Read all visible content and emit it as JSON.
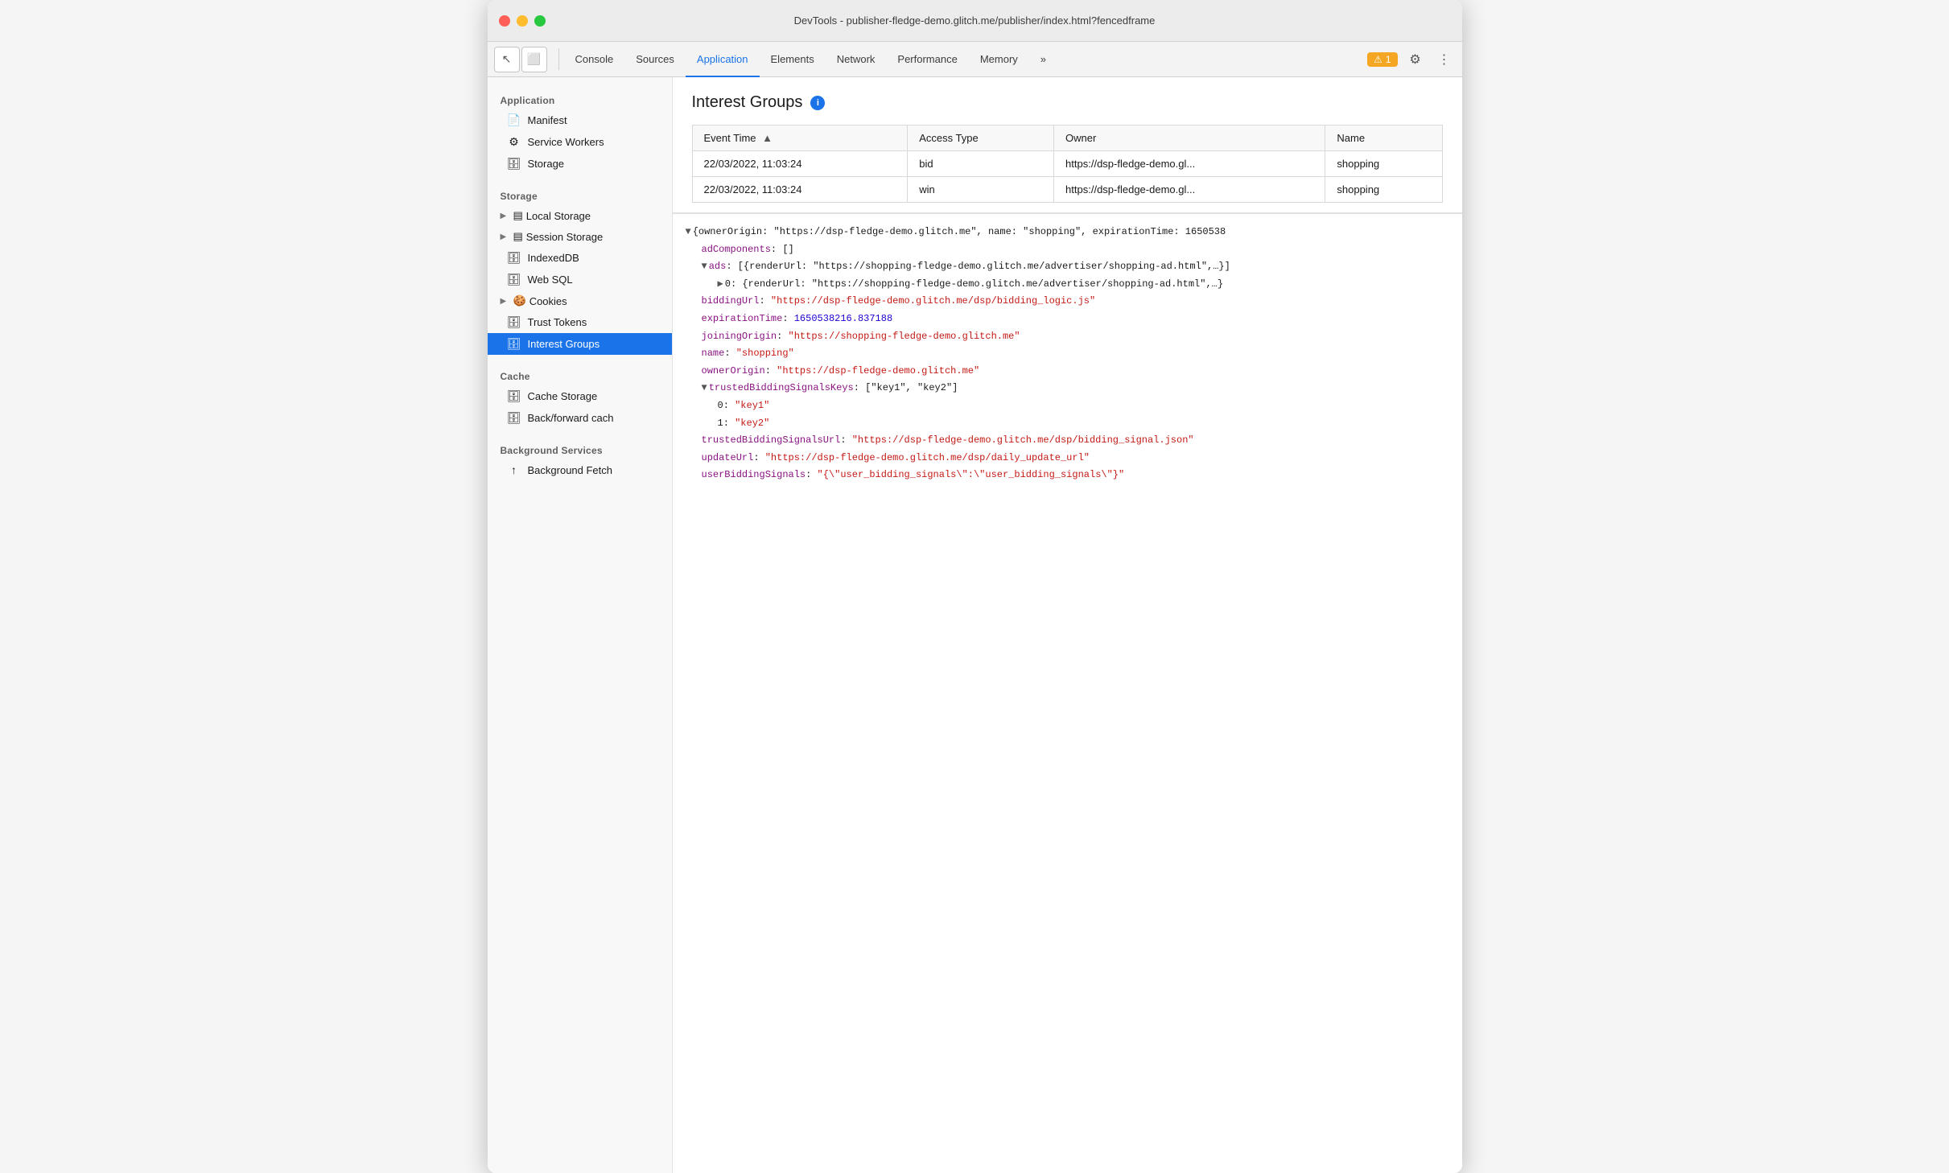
{
  "window": {
    "title": "DevTools - publisher-fledge-demo.glitch.me/publisher/index.html?fencedframe"
  },
  "toolbar": {
    "tabs": [
      {
        "id": "console",
        "label": "Console",
        "active": false
      },
      {
        "id": "sources",
        "label": "Sources",
        "active": false
      },
      {
        "id": "application",
        "label": "Application",
        "active": true
      },
      {
        "id": "elements",
        "label": "Elements",
        "active": false
      },
      {
        "id": "network",
        "label": "Network",
        "active": false
      },
      {
        "id": "performance",
        "label": "Performance",
        "active": false
      },
      {
        "id": "memory",
        "label": "Memory",
        "active": false
      }
    ],
    "more_label": "»",
    "warning_count": "1",
    "settings_icon": "⚙",
    "more_icon": "⋮"
  },
  "sidebar": {
    "sections": [
      {
        "title": "Application",
        "items": [
          {
            "id": "manifest",
            "label": "Manifest",
            "icon": "📄",
            "active": false,
            "expandable": false
          },
          {
            "id": "service-workers",
            "label": "Service Workers",
            "icon": "⚙",
            "active": false,
            "expandable": false
          },
          {
            "id": "storage",
            "label": "Storage",
            "icon": "🗄",
            "active": false,
            "expandable": false
          }
        ]
      },
      {
        "title": "Storage",
        "items": [
          {
            "id": "local-storage",
            "label": "Local Storage",
            "icon": "▤",
            "active": false,
            "expandable": true,
            "expanded": false
          },
          {
            "id": "session-storage",
            "label": "Session Storage",
            "icon": "▤",
            "active": false,
            "expandable": true,
            "expanded": false
          },
          {
            "id": "indexeddb",
            "label": "IndexedDB",
            "icon": "🗄",
            "active": false,
            "expandable": false
          },
          {
            "id": "web-sql",
            "label": "Web SQL",
            "icon": "🗄",
            "active": false,
            "expandable": false
          },
          {
            "id": "cookies",
            "label": "Cookies",
            "icon": "🍪",
            "active": false,
            "expandable": true,
            "expanded": false
          },
          {
            "id": "trust-tokens",
            "label": "Trust Tokens",
            "icon": "🗄",
            "active": false,
            "expandable": false
          },
          {
            "id": "interest-groups",
            "label": "Interest Groups",
            "icon": "🗄",
            "active": true,
            "expandable": false
          }
        ]
      },
      {
        "title": "Cache",
        "items": [
          {
            "id": "cache-storage",
            "label": "Cache Storage",
            "icon": "🗄",
            "active": false,
            "expandable": false
          },
          {
            "id": "back-forward-cache",
            "label": "Back/forward cach",
            "icon": "🗄",
            "active": false,
            "expandable": false
          }
        ]
      },
      {
        "title": "Background Services",
        "items": [
          {
            "id": "background-fetch",
            "label": "Background Fetch",
            "icon": "↑",
            "active": false,
            "expandable": false
          }
        ]
      }
    ]
  },
  "content": {
    "title": "Interest Groups",
    "table": {
      "columns": [
        {
          "id": "event-time",
          "label": "Event Time",
          "sortable": true,
          "sort_arrow": "▲"
        },
        {
          "id": "access-type",
          "label": "Access Type",
          "sortable": false
        },
        {
          "id": "owner",
          "label": "Owner",
          "sortable": false
        },
        {
          "id": "name",
          "label": "Name",
          "sortable": false
        }
      ],
      "rows": [
        {
          "event_time": "22/03/2022, 11:03:24",
          "access_type": "bid",
          "owner": "https://dsp-fledge-demo.gl...",
          "name": "shopping"
        },
        {
          "event_time": "22/03/2022, 11:03:24",
          "access_type": "win",
          "owner": "https://dsp-fledge-demo.gl...",
          "name": "shopping"
        }
      ]
    },
    "detail": {
      "lines": [
        {
          "indent": 0,
          "toggle": "▼",
          "key": "",
          "content": "{ownerOrigin: \"https://dsp-fledge-demo.glitch.me\", name: \"shopping\", expirationTime: 1650538",
          "key_color": "black",
          "type": "mixed"
        },
        {
          "indent": 1,
          "toggle": "",
          "key": "adComponents",
          "sep": ": ",
          "value": "[]",
          "key_color": "purple",
          "value_color": "black"
        },
        {
          "indent": 1,
          "toggle": "▼",
          "key": "ads",
          "sep": ": ",
          "value": "[{renderUrl: \"https://shopping-fledge-demo.glitch.me/advertiser/shopping-ad.html\",…}]",
          "key_color": "purple",
          "value_color": "black"
        },
        {
          "indent": 2,
          "toggle": "▶",
          "key": "0",
          "sep": ": ",
          "value": "{renderUrl: \"https://shopping-fledge-demo.glitch.me/advertiser/shopping-ad.html\",…}",
          "key_color": "black",
          "value_color": "black"
        },
        {
          "indent": 1,
          "toggle": "",
          "key": "biddingUrl",
          "sep": ": ",
          "value": "\"https://dsp-fledge-demo.glitch.me/dsp/bidding_logic.js\"",
          "key_color": "purple",
          "value_color": "url"
        },
        {
          "indent": 1,
          "toggle": "",
          "key": "expirationTime",
          "sep": ": ",
          "value": "1650538216.837188",
          "key_color": "purple",
          "value_color": "number"
        },
        {
          "indent": 1,
          "toggle": "",
          "key": "joiningOrigin",
          "sep": ": ",
          "value": "\"https://shopping-fledge-demo.glitch.me\"",
          "key_color": "purple",
          "value_color": "url"
        },
        {
          "indent": 1,
          "toggle": "",
          "key": "name",
          "sep": ": ",
          "value": "\"shopping\"",
          "key_color": "purple",
          "value_color": "string"
        },
        {
          "indent": 1,
          "toggle": "",
          "key": "ownerOrigin",
          "sep": ": ",
          "value": "\"https://dsp-fledge-demo.glitch.me\"",
          "key_color": "purple",
          "value_color": "url"
        },
        {
          "indent": 1,
          "toggle": "▼",
          "key": "trustedBiddingSignalsKeys",
          "sep": ": ",
          "value": "[\"key1\", \"key2\"]",
          "key_color": "purple",
          "value_color": "black"
        },
        {
          "indent": 2,
          "toggle": "",
          "key": "0",
          "sep": ": ",
          "value": "\"key1\"",
          "key_color": "black",
          "value_color": "string"
        },
        {
          "indent": 2,
          "toggle": "",
          "key": "1",
          "sep": ": ",
          "value": "\"key2\"",
          "key_color": "black",
          "value_color": "string"
        },
        {
          "indent": 1,
          "toggle": "",
          "key": "trustedBiddingSignalsUrl",
          "sep": ": ",
          "value": "\"https://dsp-fledge-demo.glitch.me/dsp/bidding_signal.json\"",
          "key_color": "purple",
          "value_color": "url"
        },
        {
          "indent": 1,
          "toggle": "",
          "key": "updateUrl",
          "sep": ": ",
          "value": "\"https://dsp-fledge-demo.glitch.me/dsp/daily_update_url\"",
          "key_color": "purple",
          "value_color": "url"
        },
        {
          "indent": 1,
          "toggle": "",
          "key": "userBiddingSignals",
          "sep": ": ",
          "value": "\"{\\\"user_bidding_signals\\\":\\\"user_bidding_signals\\\"}\"",
          "key_color": "purple",
          "value_color": "string"
        }
      ]
    }
  }
}
